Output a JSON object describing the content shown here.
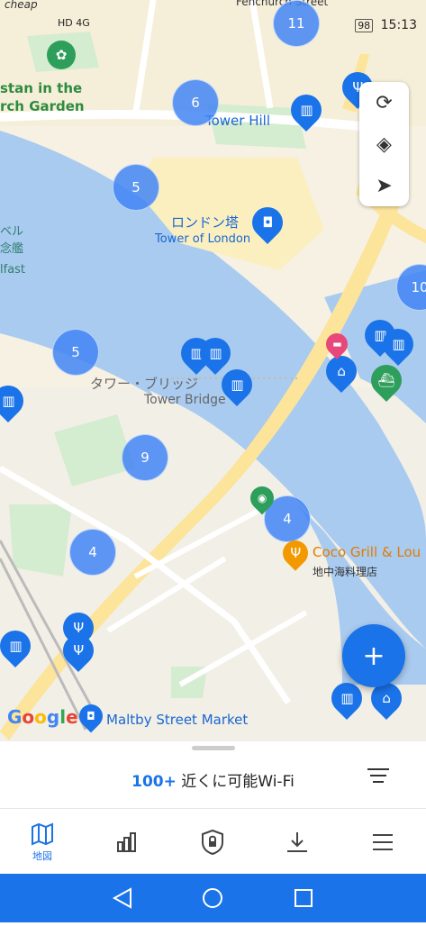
{
  "status": {
    "network": "HD 4G",
    "battery": "98",
    "time": "15:13"
  },
  "map": {
    "labels": {
      "fenchurch": "Fenchurch Street",
      "garden": "stan in the\nrch Garden",
      "tower_hill": "Tower Hill",
      "tower_jp": "ロンドン塔",
      "tower_en": "Tower of London",
      "bridge_jp": "タワー・ブリッジ",
      "bridge_en": "Tower Bridge",
      "coco": "Coco Grill & Lou",
      "coco_jp": "地中海料理店",
      "maltby": "Maltby Street Market",
      "belfast_jp": "ベル\n念艦",
      "belfast_en": "lfast",
      "cheap": "cheap",
      "google": "Google"
    },
    "clusters": [
      "11",
      "6",
      "5",
      "10",
      "5",
      "9",
      "4",
      "4"
    ]
  },
  "sheet": {
    "count": "100+",
    "text": " 近くに可能Wi-Fi"
  },
  "nav": {
    "map_label": "地図"
  },
  "colors": {
    "accent": "#1a73e8",
    "water": "#aacbf0",
    "park": "#d4ecd0",
    "road": "#fce49a"
  }
}
